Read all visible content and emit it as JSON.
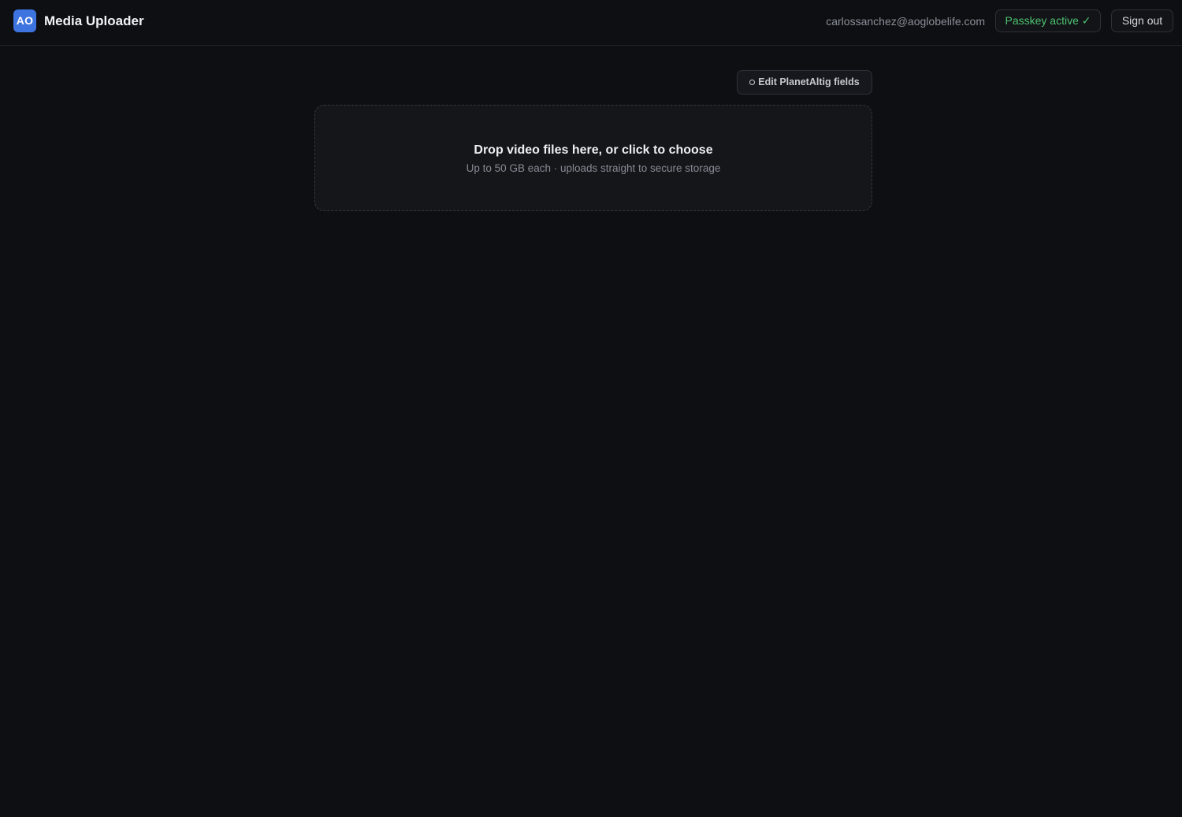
{
  "header": {
    "logo_text": "AO",
    "app_title": "Media Uploader",
    "user_email": "carlossanchez@aoglobelife.com",
    "passkey_status": "Passkey active ✓",
    "sign_out_label": "Sign out"
  },
  "toolbar": {
    "edit_fields_label": "Edit PlanetAltig fields",
    "edit_fields_icon": "circle-icon"
  },
  "dropzone": {
    "title": "Drop video files here, or click to choose",
    "subtitle": "Up to 50 GB each · uploads straight to secure storage"
  },
  "colors": {
    "background": "#0e0f12",
    "accent": "#3d74e0",
    "success": "#4cc470"
  }
}
